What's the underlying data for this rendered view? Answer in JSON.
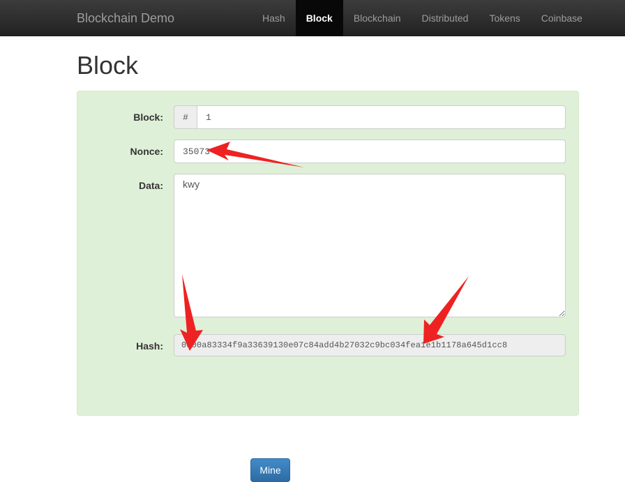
{
  "navbar": {
    "brand": "Blockchain Demo",
    "items": [
      {
        "label": "Hash",
        "active": false
      },
      {
        "label": "Block",
        "active": true
      },
      {
        "label": "Blockchain",
        "active": false
      },
      {
        "label": "Distributed",
        "active": false
      },
      {
        "label": "Tokens",
        "active": false
      },
      {
        "label": "Coinbase",
        "active": false
      }
    ]
  },
  "page": {
    "title": "Block"
  },
  "form": {
    "block": {
      "label": "Block:",
      "addon": "#",
      "value": "1",
      "placeholder": ""
    },
    "nonce": {
      "label": "Nonce:",
      "value": "35073",
      "placeholder": ""
    },
    "data": {
      "label": "Data:",
      "value": "kwy",
      "placeholder": ""
    },
    "hash": {
      "label": "Hash:",
      "value": "0000a83334f9a33639130e07c84add4b27032c9bc034fea1e1b1178a645d1cc8",
      "placeholder": ""
    },
    "mine_button": "Mine"
  },
  "annotations": {
    "arrow_color": "#ee2222",
    "arrows": [
      {
        "name": "arrow-to-nonce",
        "points_at": "nonce-field"
      },
      {
        "name": "arrow-to-hash-left",
        "points_at": "hash-field"
      },
      {
        "name": "arrow-to-hash-right",
        "points_at": "hash-field"
      }
    ]
  },
  "colors": {
    "panel_background": "#dff0d8",
    "panel_border": "#d6e9c6",
    "navbar_background": "#222222",
    "active_tab_background": "#080808",
    "primary_button": "#428bca",
    "readonly_field": "#eeeeee"
  }
}
